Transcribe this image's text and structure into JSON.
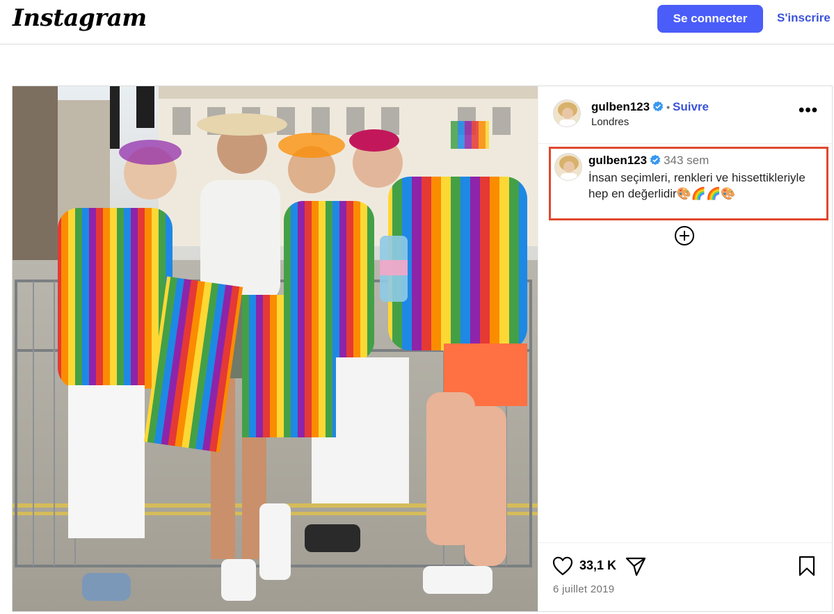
{
  "header": {
    "logo": "Instagram",
    "login_label": "Se connecter",
    "signup_label": "S'inscrire",
    "accent_color": "#4a5df9"
  },
  "post": {
    "username": "gulben123",
    "follow_label": "Suivre",
    "dot": "•",
    "location": "Londres",
    "more_label": "•••",
    "caption": {
      "username": "gulben123",
      "time_ago": "343 sem",
      "text": "İnsan seçimleri, renkleri ve hissettikleriyle hep en değerlidir🎨🌈🌈🎨"
    },
    "likes": "33,1 K",
    "date": "6 juillet 2019",
    "highlight_color": "#e0482e",
    "icons": [
      "verified-badge-icon",
      "more-options-icon",
      "add-comment-icon",
      "heart-icon",
      "share-icon",
      "bookmark-icon"
    ]
  }
}
